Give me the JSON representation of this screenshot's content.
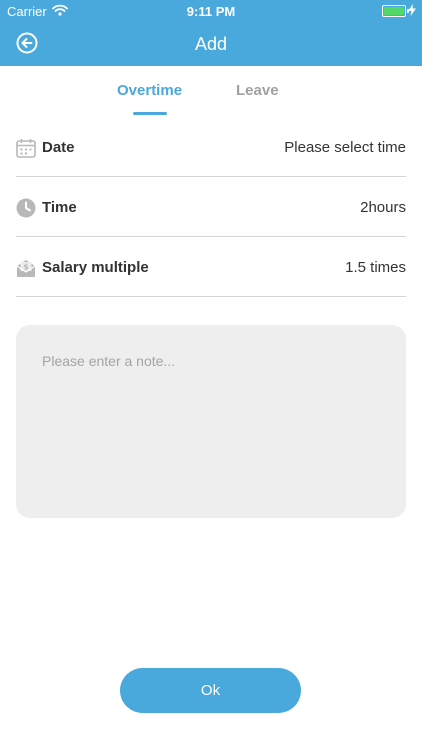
{
  "status_bar": {
    "carrier": "Carrier",
    "time": "9:11 PM",
    "battery_percent": 100,
    "battery_color": "#53d769"
  },
  "header": {
    "title": "Add",
    "back_icon": "circle-arrow-left-icon",
    "background_color": "#4aa9dc"
  },
  "tabs": [
    {
      "label": "Overtime",
      "active": true
    },
    {
      "label": "Leave",
      "active": false
    }
  ],
  "form": {
    "rows": [
      {
        "label": "Date",
        "value": "Please select time",
        "icon": "calendar-icon"
      },
      {
        "label": "Time",
        "value": "2hours",
        "icon": "clock-icon"
      },
      {
        "label": "Salary multiple",
        "value": "1.5 times",
        "icon": "salary-envelope-icon"
      }
    ],
    "note": {
      "placeholder": "Please enter a note...",
      "value": ""
    }
  },
  "actions": {
    "ok_label": "Ok"
  },
  "colors": {
    "accent": "#4aa9dc",
    "inactive_tab": "#a0a0a0",
    "note_background": "#eeeeee"
  }
}
